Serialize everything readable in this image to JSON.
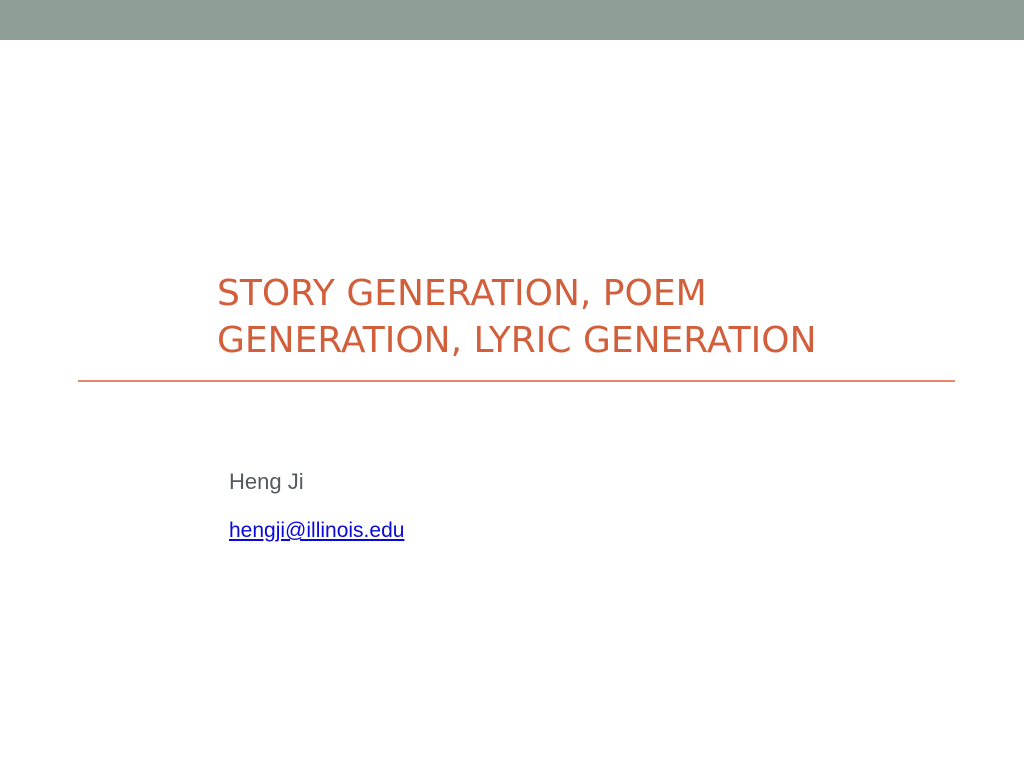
{
  "slide": {
    "title_lines": [
      "STORY GENERATION, POEM",
      "GENERATION, LYRIC GENERATION"
    ],
    "author": "Heng Ji",
    "email": "hengji@illinois.edu"
  },
  "colors": {
    "top_bar": "#909e98",
    "title": "#d25f3c",
    "divider": "#e4876a",
    "author": "#555a5e",
    "link": "#0a0ad8",
    "background": "#ffffff"
  }
}
